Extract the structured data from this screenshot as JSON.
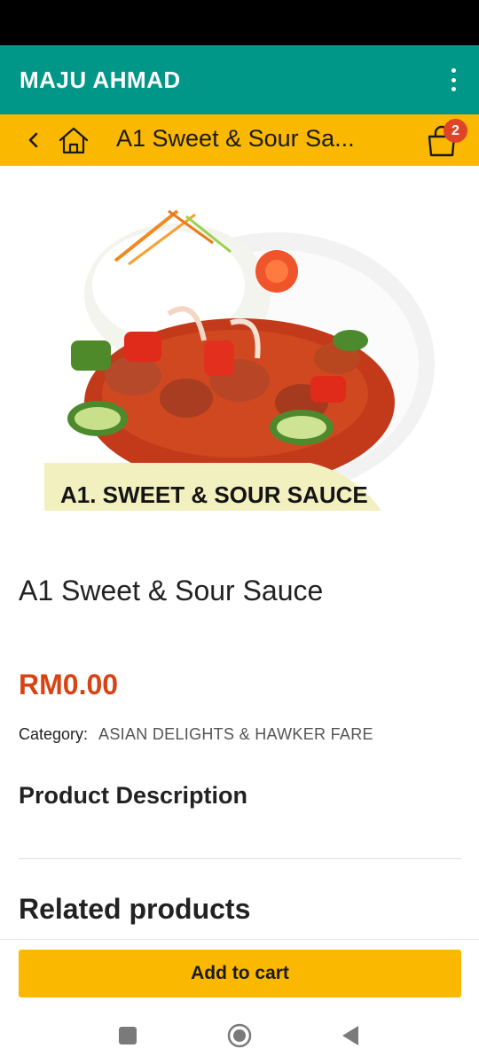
{
  "app_bar": {
    "title": "MAJU AHMAD",
    "overflow_icon": "more-vert-icon"
  },
  "sub_bar": {
    "back_icon": "chevron-left-icon",
    "home_icon": "home-icon",
    "title": "A1 Sweet & Sour Sa...",
    "cart_icon": "shopping-bag-icon",
    "cart_count": "2"
  },
  "product": {
    "image_caption": "A1. SWEET & SOUR SAUCE",
    "name": "A1 Sweet & Sour Sauce",
    "price": "RM0.00",
    "category_label": "Category:",
    "category_value": "ASIAN DELIGHTS & HAWKER FARE",
    "description_heading": "Product Description",
    "related_heading": "Related products"
  },
  "actions": {
    "add_to_cart": "Add to cart"
  },
  "nav": {
    "recents_icon": "recents-icon",
    "home_icon": "home-circle-icon",
    "back_icon": "back-triangle-icon"
  },
  "colors": {
    "primary": "#009688",
    "accent": "#fbb800",
    "price": "#d84315",
    "badge": "#e04428"
  }
}
